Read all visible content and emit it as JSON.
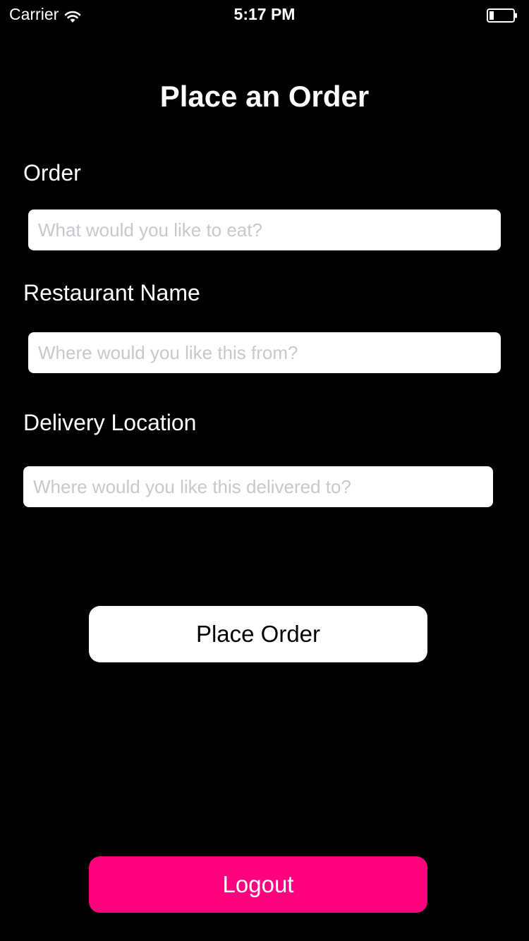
{
  "status_bar": {
    "carrier": "Carrier",
    "time": "5:17 PM",
    "wifi_icon": "wifi-icon",
    "battery_icon": "battery-icon"
  },
  "title": "Place an Order",
  "form": {
    "order": {
      "label": "Order",
      "placeholder": "What would you like to eat?",
      "value": ""
    },
    "restaurant": {
      "label": "Restaurant Name",
      "placeholder": "Where would you like this from?",
      "value": ""
    },
    "delivery": {
      "label": "Delivery Location",
      "placeholder": "Where would you like this delivered to?",
      "value": ""
    }
  },
  "buttons": {
    "place_order": "Place Order",
    "logout": "Logout"
  },
  "colors": {
    "background": "#000000",
    "logout_button": "#ff007f",
    "placeholder": "#c7c7cd"
  }
}
